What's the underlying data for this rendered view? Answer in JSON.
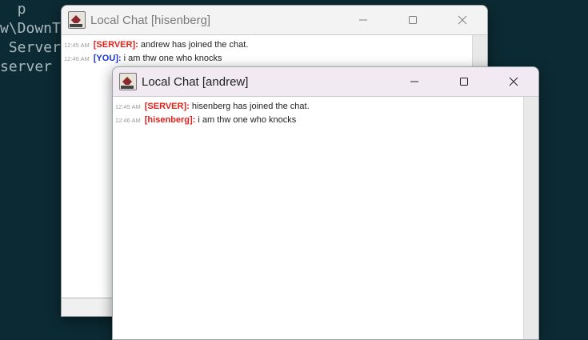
{
  "terminal": {
    "lines": [
      "  p",
      "w\\DownT",
      " Server",
      "server"
    ]
  },
  "back_window": {
    "title": "Local Chat [hisenberg]",
    "messages": [
      {
        "time": "12:45 AM",
        "sender": "[SERVER]:",
        "sender_color": "#e0201b",
        "text": "andrew has joined the chat."
      },
      {
        "time": "12:46 AM",
        "sender": "[YOU]:",
        "sender_color": "#1a35d6",
        "text": "i am thw one who knocks"
      }
    ]
  },
  "front_window": {
    "title": "Local Chat [andrew]",
    "messages": [
      {
        "time": "12:45 AM",
        "sender": "[SERVER]:",
        "sender_color": "#e0201b",
        "text": "hisenberg has joined the chat."
      },
      {
        "time": "12:46 AM",
        "sender": "[hisenberg]:",
        "sender_color": "#e0201b",
        "text": "i am thw one who knocks"
      }
    ]
  },
  "icons": {
    "minimize": "minimize-icon",
    "maximize": "maximize-icon",
    "close": "close-icon",
    "app": "java-app-icon"
  }
}
